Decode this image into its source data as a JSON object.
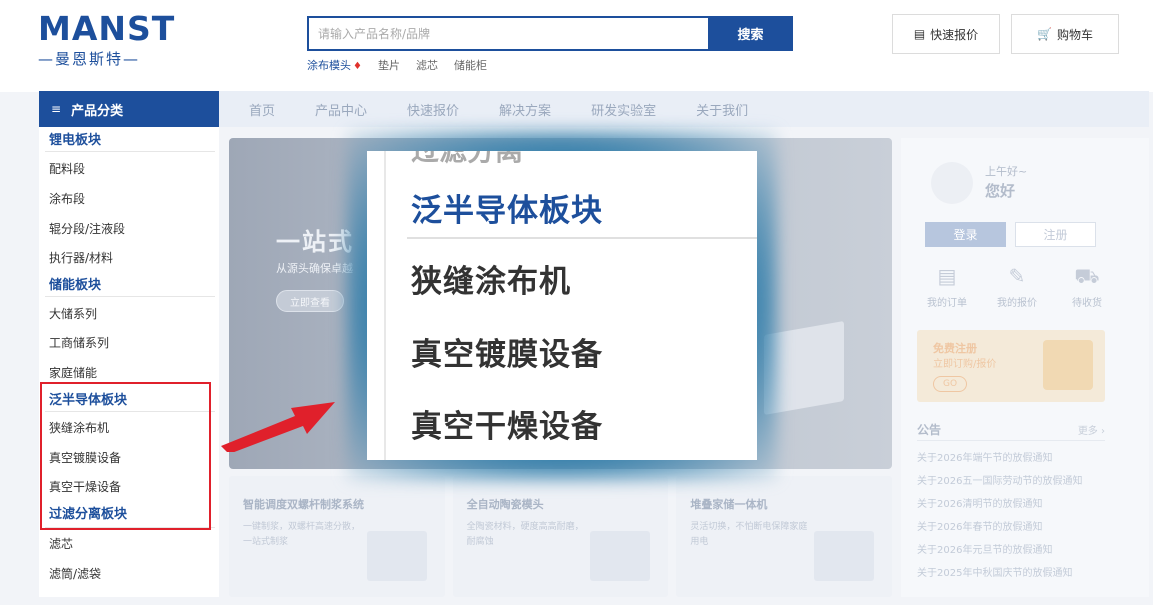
{
  "logo": {
    "main": "MANST",
    "sub": "—曼恩斯特—"
  },
  "search": {
    "placeholder": "请输入产品名称/品牌",
    "button": "搜索"
  },
  "hotwords": [
    {
      "label": "涂布模头",
      "hot": true
    },
    {
      "label": "垫片",
      "hot": false
    },
    {
      "label": "滤芯",
      "hot": false
    },
    {
      "label": "储能柜",
      "hot": false
    }
  ],
  "header_buttons": {
    "quote": "快速报价",
    "cart": "购物车"
  },
  "category_button": "产品分类",
  "nav": [
    "首页",
    "产品中心",
    "快速报价",
    "解决方案",
    "研发实验室",
    "关于我们"
  ],
  "sidebar": {
    "sections": [
      {
        "head": "锂电板块",
        "items": [
          "配料段",
          "涂布段",
          "辊分段/注液段",
          "执行器/材料"
        ]
      },
      {
        "head": "储能板块",
        "items": [
          "大储系列",
          "工商储系列",
          "家庭储能"
        ]
      },
      {
        "head": "泛半导体板块",
        "items": [
          "狭缝涂布机",
          "真空镀膜设备",
          "真空干燥设备"
        ]
      },
      {
        "head": "过滤分离板块",
        "items": [
          "滤芯",
          "滤筒/滤袋"
        ]
      }
    ]
  },
  "banner": {
    "title": "一站式",
    "subtitle": "从源头确保卓越",
    "button": "立即查看"
  },
  "tiles": [
    {
      "title": "智能调度双螺杆制浆系统",
      "desc": "一键制浆，双螺杆高速分散，一站式制浆"
    },
    {
      "title": "全自动陶瓷模头",
      "desc": "全陶瓷材料，硬度高高耐磨，耐腐蚀"
    },
    {
      "title": "堆叠家储一体机",
      "desc": "灵活切换，不怕断电保障家庭用电"
    }
  ],
  "user_panel": {
    "greeting": "上午好~",
    "hello": "您好",
    "login": "登录",
    "register": "注册",
    "shortcuts": [
      {
        "icon": "order-icon",
        "label": "我的订单"
      },
      {
        "icon": "quote-icon",
        "label": "我的报价"
      },
      {
        "icon": "truck-icon",
        "label": "待收货"
      }
    ],
    "promo": {
      "line1": "免费注册",
      "line2": "立即订购/报价",
      "go": "GO"
    },
    "notice_title": "公告",
    "notice_more": "更多 ›",
    "notices": [
      "关于2026年端午节的放假通知",
      "关于2026五一国际劳动节的放假通知",
      "关于2026清明节的放假通知",
      "关于2026年春节的放假通知",
      "关于2026年元旦节的放假通知",
      "关于2025年中秋国庆节的放假通知"
    ]
  },
  "zoom": {
    "top_partial": "过滤分离",
    "head": "泛半导体板块",
    "items": [
      "狭缝涂布机",
      "真空镀膜设备",
      "真空干燥设备"
    ]
  },
  "colors": {
    "brand": "#1d4f9c",
    "highlight_box": "#e0202b",
    "arrow": "#e0202b"
  }
}
